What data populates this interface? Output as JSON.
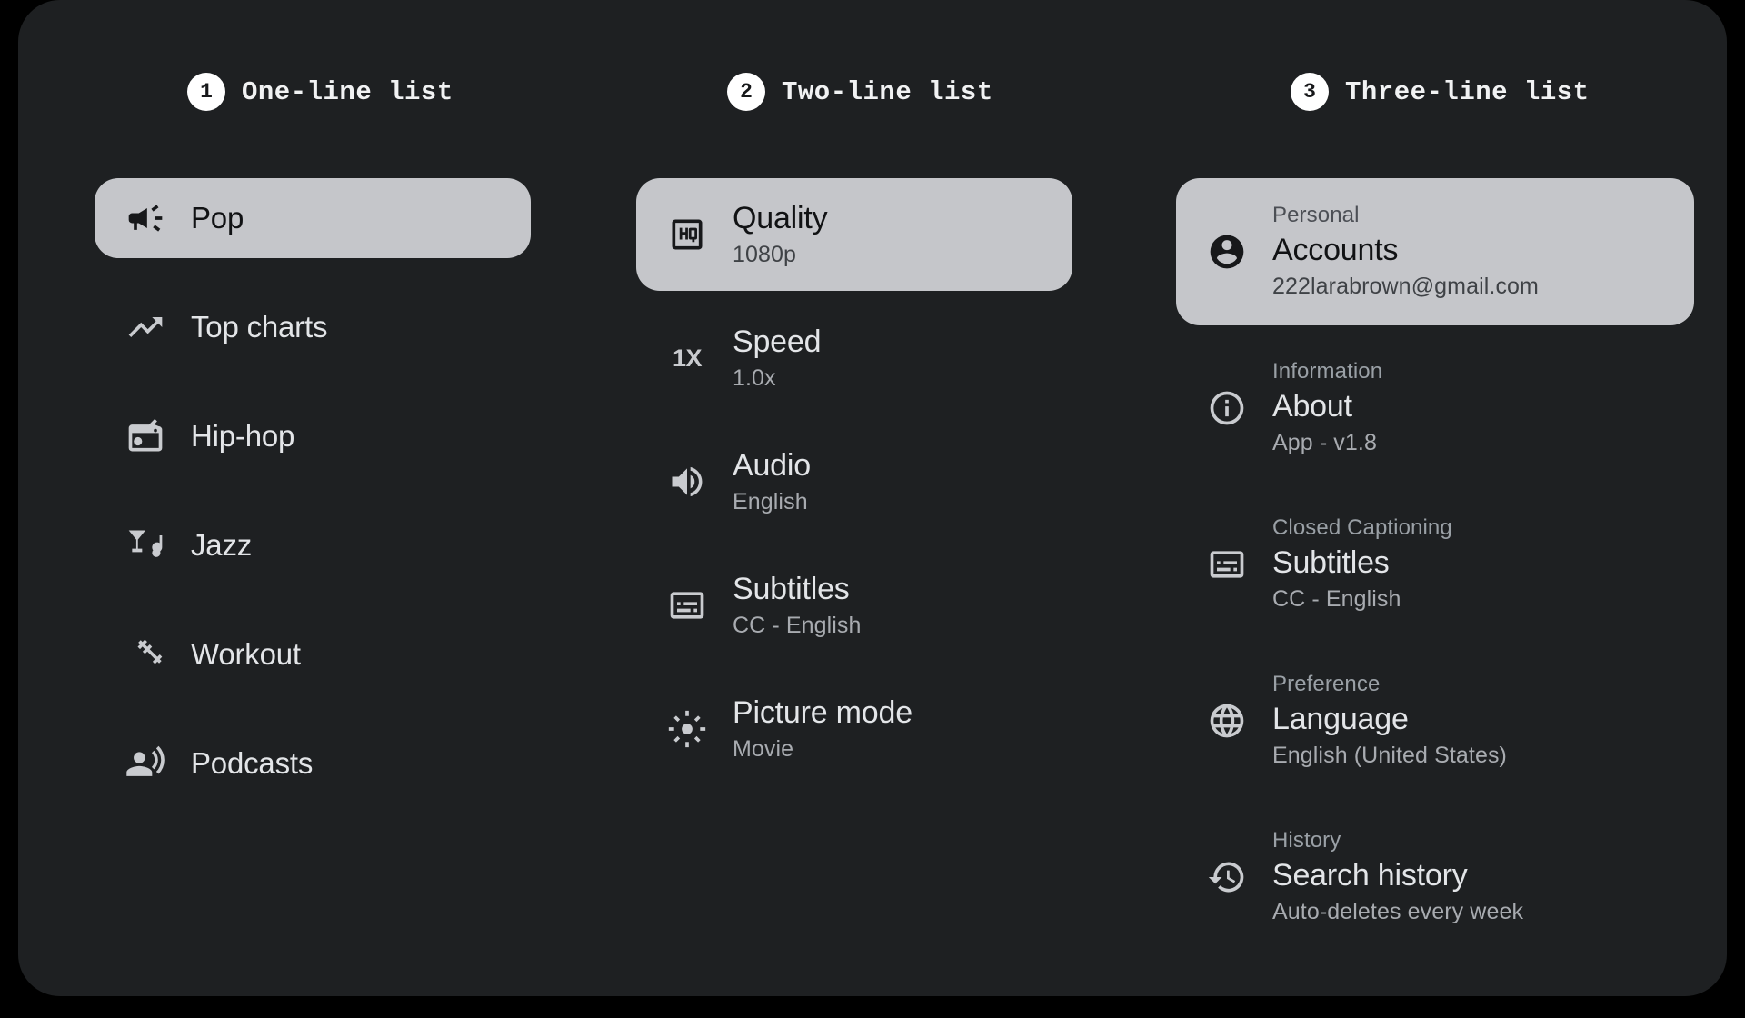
{
  "theme": {
    "page_background": "#000000",
    "surface_background": "#1e2022",
    "selected_background": "#c5c6ca",
    "primary_text": "#e3e5e8",
    "secondary_text": "#a8abb0",
    "badge_background": "#ffffff"
  },
  "columns": [
    {
      "badge": "1",
      "title": "One-line list",
      "kind": "one-line",
      "items": [
        {
          "icon": "campaign-icon",
          "headline": "Pop",
          "selected": true
        },
        {
          "icon": "trending-up-icon",
          "headline": "Top charts",
          "selected": false
        },
        {
          "icon": "radio-icon",
          "headline": "Hip-hop",
          "selected": false
        },
        {
          "icon": "nightlife-icon",
          "headline": "Jazz",
          "selected": false
        },
        {
          "icon": "fitness-icon",
          "headline": "Workout",
          "selected": false
        },
        {
          "icon": "podcasts-icon",
          "headline": "Podcasts",
          "selected": false
        }
      ]
    },
    {
      "badge": "2",
      "title": "Two-line list",
      "kind": "two-line",
      "items": [
        {
          "icon": "hq-icon",
          "headline": "Quality",
          "supporting": "1080p",
          "selected": true
        },
        {
          "icon": "speed-1x-icon",
          "headline": "Speed",
          "supporting": "1.0x",
          "selected": false
        },
        {
          "icon": "volume-up-icon",
          "headline": "Audio",
          "supporting": "English",
          "selected": false
        },
        {
          "icon": "subtitles-icon",
          "headline": "Subtitles",
          "supporting": "CC - English",
          "selected": false
        },
        {
          "icon": "brightness-icon",
          "headline": "Picture mode",
          "supporting": "Movie",
          "selected": false
        }
      ]
    },
    {
      "badge": "3",
      "title": "Three-line list",
      "kind": "three-line",
      "items": [
        {
          "icon": "account-circle-icon",
          "overline": "Personal",
          "headline": "Accounts",
          "supporting": "222larabrown@gmail.com",
          "selected": true
        },
        {
          "icon": "info-icon",
          "overline": "Information",
          "headline": "About",
          "supporting": "App - v1.8",
          "selected": false
        },
        {
          "icon": "subtitles-icon",
          "overline": "Closed Captioning",
          "headline": "Subtitles",
          "supporting": "CC - English",
          "selected": false
        },
        {
          "icon": "language-icon",
          "overline": "Preference",
          "headline": "Language",
          "supporting": "English (United States)",
          "selected": false
        },
        {
          "icon": "history-icon",
          "overline": "History",
          "headline": "Search history",
          "supporting": "Auto-deletes every week",
          "selected": false
        }
      ]
    }
  ]
}
